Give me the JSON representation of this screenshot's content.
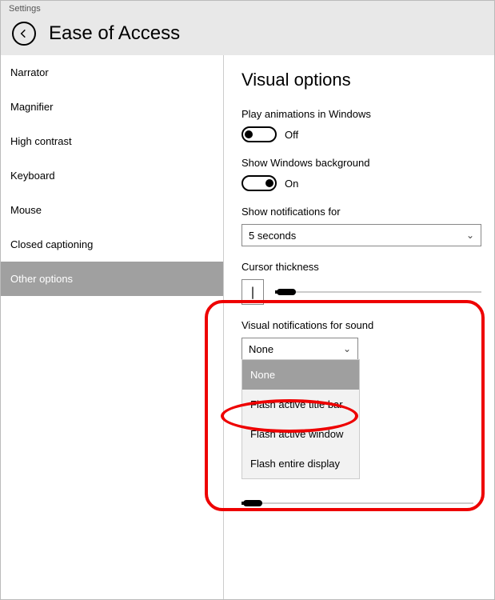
{
  "window": {
    "title": "Settings"
  },
  "header": {
    "title": "Ease of Access"
  },
  "sidebar": {
    "items": [
      {
        "label": "Narrator"
      },
      {
        "label": "Magnifier"
      },
      {
        "label": "High contrast"
      },
      {
        "label": "Keyboard"
      },
      {
        "label": "Mouse"
      },
      {
        "label": "Closed captioning"
      },
      {
        "label": "Other options"
      }
    ],
    "selected_index": 6
  },
  "content": {
    "section_title": "Visual options",
    "play_animations": {
      "label": "Play animations in Windows",
      "state": "Off"
    },
    "show_background": {
      "label": "Show Windows background",
      "state": "On"
    },
    "show_notifications": {
      "label": "Show notifications for",
      "value": "5 seconds"
    },
    "cursor_thickness": {
      "label": "Cursor thickness",
      "preview": "|"
    },
    "visual_notifications": {
      "label": "Visual notifications for sound",
      "value": "None",
      "options": [
        "None",
        "Flash active title bar",
        "Flash active window",
        "Flash entire display"
      ]
    }
  }
}
